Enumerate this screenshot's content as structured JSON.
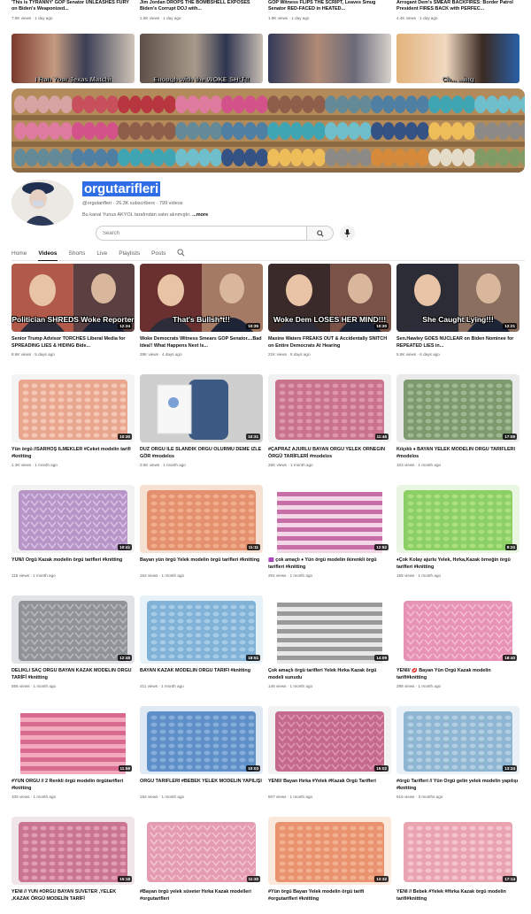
{
  "top_videos": [
    {
      "title": "'This is TYRANNY' GOP Senator UNLEASHES FURY on Biden's Weaponized...",
      "meta": "7.8K views · 1 day ago",
      "caption": "I Run Your Texas Matchi"
    },
    {
      "title": "Jim Jordan DROPS THE BOMBSHELL EXPOSES Biden's Corrupt DOJ with...",
      "meta": "1.6K views · 1 day ago",
      "caption": "Enough with the WOKE SH*T!!"
    },
    {
      "title": "GOP Witness FLIPS THE SCRIPT, Leaves Smug Senator RED-FACED in HEATED...",
      "meta": "1.9K views · 1 day ago",
      "caption": ""
    },
    {
      "title": "Arrogant Dem's SMEAR BACKFIRES: Border Patrol President FIRES BACK with PERFEC...",
      "meta": "4.4K views · 1 day ago",
      "caption": "Ch... ...ing"
    }
  ],
  "channel": {
    "name": "orgutarifleri",
    "handle": "@orgutarifleri",
    "subscribers": "26.3K subscribers",
    "videos_count": "799 videos",
    "description": "Bu kanal Yunus AKYOL tarafından satın alınmıştır.",
    "more_label": "...more"
  },
  "search": {
    "placeholder": "Search"
  },
  "tabs": [
    "Home",
    "Videos",
    "Shorts",
    "Live",
    "Playlists",
    "Posts"
  ],
  "active_tab": "Videos",
  "videos": [
    {
      "title": "Senior Trump Advisor TORCHES Liberal Media for SPREADING LIES & HIDING Bide...",
      "meta": "8.6K views · 5 days ago",
      "duration": "12:34",
      "caption": "Politician SHREDS Woke Reporter",
      "kind": "news",
      "colors": [
        "#b25a4a",
        "#5a4040",
        "#c7c7c7"
      ]
    },
    {
      "title": "Woke Democrats Witness Smears GOP Senator....Bad Idea!! What Happens Next Is...",
      "meta": "28K views · 4 days ago",
      "duration": "10:35",
      "caption": "That's Bullsh*t!!",
      "kind": "news",
      "colors": [
        "#6a3030",
        "#a57a64",
        "#d9d9d9"
      ]
    },
    {
      "title": "Maxine Waters FREAKS OUT & Accidentally SNITCH on Entire Democrats At Hearing",
      "meta": "21K views · 6 days ago",
      "duration": "10:30",
      "caption": "Woke Dem LOSES HER MIND!!!",
      "kind": "news",
      "colors": [
        "#3a2a2a",
        "#7a5248",
        "#9e9ea8"
      ]
    },
    {
      "title": "Sen.Hawley GOES NUCLEAR on Biden Nominee for REPEATED LIES in...",
      "meta": "5.5K views · 6 days ago",
      "duration": "12:21",
      "caption": "She Caught Lying!!!",
      "kind": "news",
      "colors": [
        "#2c2c36",
        "#8b6f60",
        "#d4cbc2"
      ]
    },
    {
      "title": "Yün örgü //SARHOŞ İLMEKLER #Ceket modelin tarifi #knitting",
      "meta": "1.3K views · 1 month ago",
      "duration": "10:30",
      "kind": "knit",
      "colors": [
        "#e9a68f",
        "#f5c8b6",
        "#f4f4f4"
      ]
    },
    {
      "title": "DÜZ ÖRGÜ İLE SLANDIK ÖRGÜ OLURMU DEME İZLE GÖR #modelos",
      "meta": "3.5K views · 1 month ago",
      "duration": "10:31",
      "kind": "yarn",
      "colors": [
        "#3d5a84",
        "#f0efef",
        "#cfcfcf"
      ]
    },
    {
      "title": "#ÇAPRAZ AJURLU BAYAN ÖRGÜ YELEK ÖRNEĞİN ÖRGÜ TARİFLERİ #modelos",
      "meta": "26K views · 1 month ago",
      "duration": "11:46",
      "kind": "knit",
      "colors": [
        "#c9728b",
        "#e096aa",
        "#f1f1f1"
      ]
    },
    {
      "title": "Kılçıklı ♦ BAYAN YELEK MODELİN ÖRGÜ TARİFLERİ #modelos",
      "meta": "103 views · 1 month ago",
      "duration": "17:09",
      "kind": "knit",
      "colors": [
        "#7d9a6f",
        "#a0b893",
        "#eaeaea"
      ]
    },
    {
      "title": "YÜN// Örgü Kazak modelin örgü tarifleri #knitting",
      "meta": "115 views · 1 month ago",
      "duration": "10:41",
      "kind": "lace",
      "colors": [
        "#b796c7",
        "#d7c0e3",
        "#f2f2f2"
      ]
    },
    {
      "title": "Bayan yün örgü Yelek modelin örgü tarifleri #knitting",
      "meta": "154 views · 1 month ago",
      "duration": "11:11",
      "kind": "knit",
      "colors": [
        "#e48f6e",
        "#f0ad8d",
        "#f6e0d2"
      ]
    },
    {
      "title": "🟪 çok amaçlı ♦ Yün örgü modelin ikirenkli örgü tarifleri #knitting",
      "meta": "291 views · 1 month ago",
      "duration": "12:52",
      "kind": "stripe",
      "colors": [
        "#c86ea6",
        "#f3d6e8",
        "#ffffff"
      ]
    },
    {
      "title": "♦Çok Kolay ajurlu Yelek, Hırka,Kazak örneğin örgü tarifleri #knitting",
      "meta": "155 views · 1 month ago",
      "duration": "8:24",
      "kind": "knit",
      "colors": [
        "#8bcf66",
        "#abe07f",
        "#e9f6e1"
      ]
    },
    {
      "title": "DELİKLİ SAÇ ÖRGÜ BAYAN KAZAK MODELİN ÖRGÜ TARİFİ #knitting",
      "meta": "555 views · 1 month ago",
      "duration": "12:48",
      "kind": "lace",
      "colors": [
        "#8f9297",
        "#b5b8bd",
        "#e0e2e5"
      ]
    },
    {
      "title": "BAYAN KAZAK MODELİN ÖRGÜ TARİFİ #knitting",
      "meta": "211 views · 1 month ago",
      "duration": "18:51",
      "kind": "knit",
      "colors": [
        "#7fb2d6",
        "#a6cbe6",
        "#e7f1f8"
      ]
    },
    {
      "title": "Çok amaçlı örgü tarifleri Yelek Hırka Kazak örgü modeli sunudu",
      "meta": "146 views · 1 month ago",
      "duration": "14:09",
      "kind": "stripe",
      "colors": [
        "#9a9a9a",
        "#e8e8e8",
        "#ffffff"
      ]
    },
    {
      "title": "YENİ// 💋 Bayan Yün Örgü Kazak modelin tarifi#knitting",
      "meta": "288 views · 1 month ago",
      "duration": "18:40",
      "kind": "lace",
      "colors": [
        "#e793b5",
        "#f3bad2",
        "#ffffff"
      ]
    },
    {
      "title": "#YÜN ÖRGÜ // 2 Renkli örgü modelin örgütarifleri #knitting",
      "meta": "105 views · 1 month ago",
      "duration": "11:59",
      "kind": "stripe",
      "colors": [
        "#d86a8f",
        "#f2a8bd",
        "#ffffff"
      ]
    },
    {
      "title": "ÖRGÜ TARİFLERİ #BEBEK YELEK MODELİN YAPILIŞI",
      "meta": "192 views · 1 month ago",
      "duration": "10:03",
      "kind": "knit",
      "colors": [
        "#5f8fc8",
        "#86aedb",
        "#dfe9f4"
      ]
    },
    {
      "title": "YENİ// Bayan Hırka #Yelek #Kazak Örgü Tarifleri",
      "meta": "507 views · 1 month ago",
      "duration": "15:02",
      "kind": "lace",
      "colors": [
        "#c46a8d",
        "#e095b0",
        "#f2f2f2"
      ]
    },
    {
      "title": "#örgü Tarifleri // Yün Örgü gelin yelek modelin yapılışı #knitting",
      "meta": "616 views · 3 months ago",
      "duration": "13:34",
      "kind": "knit",
      "colors": [
        "#8eb6d3",
        "#b2cee3",
        "#e9f1f7"
      ]
    },
    {
      "title": "YENİ // YÜN #ÖRGÜ BAYAN SÜVETER ,YELEK ,KAZAK ÖRGÜ MODELİN TARİFİ",
      "meta": "",
      "duration": "15:18",
      "kind": "knit",
      "colors": [
        "#c97491",
        "#e29cb3",
        "#f0e6ea"
      ]
    },
    {
      "title": "#Bayan örgü yelek süveter Hırka Kazak modelleri #orgutarifleri",
      "meta": "",
      "duration": "11:30",
      "kind": "lace",
      "colors": [
        "#e59bb0",
        "#f2c3d0",
        "#ffffff"
      ]
    },
    {
      "title": "#Yün örgü Bayan Yelek modelin örgü tarifi #orgutarifleri #knitting",
      "meta": "",
      "duration": "13:32",
      "kind": "knit",
      "colors": [
        "#e8926f",
        "#f2b08f",
        "#fbe9de"
      ]
    },
    {
      "title": "YENİ // Bebek #Yelek #Hırka Kazak örgü modelin tarifi#knitting",
      "meta": "",
      "duration": "17:14",
      "kind": "knit",
      "colors": [
        "#eaa3b1",
        "#f4c3cd",
        "#ffffff"
      ]
    }
  ]
}
